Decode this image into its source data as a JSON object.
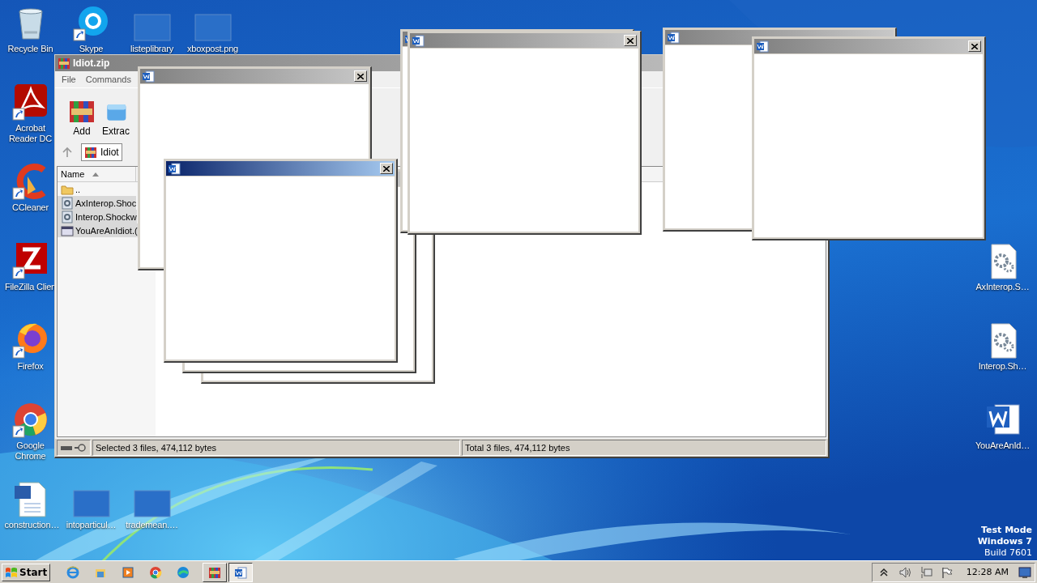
{
  "desktop": {
    "top_row": [
      {
        "label": "Recycle Bin",
        "kind": "recycle",
        "shortcut": false
      },
      {
        "label": "Skype",
        "kind": "skype",
        "shortcut": true
      },
      {
        "label": "listeplibrary",
        "kind": "blank",
        "shortcut": false
      },
      {
        "label": "xboxpost.png",
        "kind": "blank",
        "shortcut": false
      }
    ],
    "left_column": [
      {
        "label": "Acrobat Reader DC",
        "kind": "acrobat",
        "shortcut": true
      },
      {
        "label": "CCleaner",
        "kind": "ccleaner",
        "shortcut": true
      },
      {
        "label": "FileZilla Clien",
        "kind": "filezilla",
        "shortcut": true
      },
      {
        "label": "Firefox",
        "kind": "firefox",
        "shortcut": true
      },
      {
        "label": "Google Chrome",
        "kind": "chrome",
        "shortcut": true
      },
      {
        "label": "construction…",
        "kind": "worddoc",
        "shortcut": false
      }
    ],
    "bottom_row": [
      {
        "label": "intoparticul…",
        "kind": "blank",
        "shortcut": false
      },
      {
        "label": "trademean.…",
        "kind": "blank",
        "shortcut": false
      }
    ],
    "right_column": [
      {
        "label": "AxInterop.S…",
        "kind": "gear",
        "shortcut": false
      },
      {
        "label": "Interop.Sh…",
        "kind": "gear",
        "shortcut": false
      },
      {
        "label": "YouAreAnId…",
        "kind": "word",
        "shortcut": false
      }
    ]
  },
  "archive_window": {
    "title": "Idiot.zip",
    "active": false,
    "menu": [
      "File",
      "Commands"
    ],
    "toolbar": [
      {
        "label": "Add",
        "kind": "add"
      },
      {
        "label": "Extrac",
        "kind": "extract"
      }
    ],
    "address": "Idiot",
    "columns": [
      {
        "label": "Name",
        "sorted": true
      }
    ],
    "rows": [
      {
        "name": "..",
        "kind": "folder",
        "selected": false
      },
      {
        "name": "AxInterop.Shoc",
        "kind": "dll",
        "selected": true
      },
      {
        "name": "Interop.Shockw",
        "kind": "dll",
        "selected": true
      },
      {
        "name": "YouAreAnIdiot.(",
        "kind": "exe",
        "selected": true
      }
    ],
    "status": [
      "Selected 3 files, 474,112 bytes",
      "Total 3 files, 474,112 bytes"
    ]
  },
  "popups": [
    {
      "kind": "window",
      "active": false
    },
    {
      "kind": "frame"
    },
    {
      "kind": "frame"
    },
    {
      "kind": "window",
      "active": true
    },
    {
      "kind": "window",
      "active": false
    },
    {
      "kind": "window",
      "active": false
    },
    {
      "kind": "window",
      "active": false
    },
    {
      "kind": "window",
      "active": false
    }
  ],
  "os_notice": [
    {
      "text": "Test Mode",
      "bold": true
    },
    {
      "text": "Windows 7",
      "bold": true
    },
    {
      "text": "Build 7601",
      "bold": false
    }
  ],
  "taskbar": {
    "start": "Start",
    "pinned": [
      {
        "kind": "ie"
      },
      {
        "kind": "explorer"
      },
      {
        "kind": "media"
      },
      {
        "kind": "chrome"
      },
      {
        "kind": "edge"
      }
    ],
    "tasks": [
      {
        "kind": "winrar",
        "selected": false
      },
      {
        "kind": "word",
        "selected": true
      }
    ],
    "tray": [
      {
        "kind": "chevron"
      },
      {
        "kind": "speaker"
      },
      {
        "kind": "network"
      },
      {
        "kind": "flag"
      }
    ],
    "clock": "12:28 AM"
  }
}
